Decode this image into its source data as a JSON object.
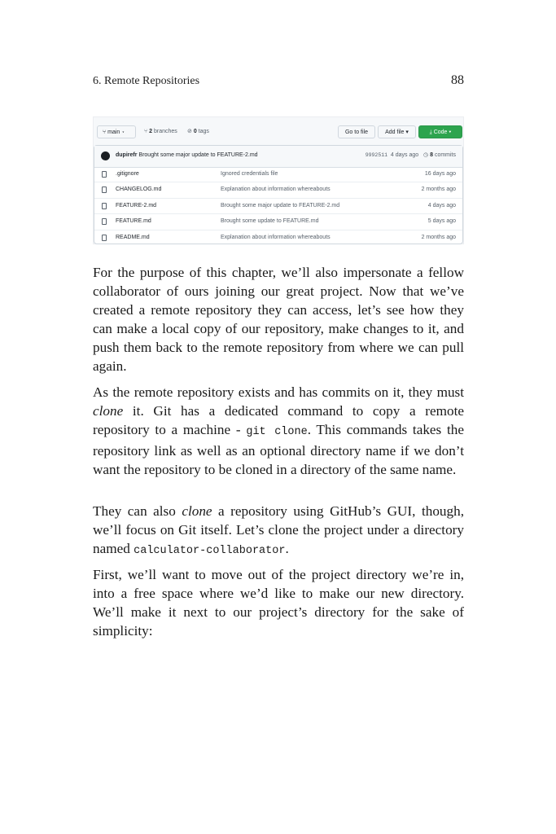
{
  "header": {
    "chapter": "6. Remote Repositories",
    "page_number": "88"
  },
  "repo_screenshot": {
    "branch_button": "main ▾",
    "branches_count": "2",
    "branches_label": "branches",
    "tags_count": "0",
    "tags_label": "tags",
    "go_to_file": "Go to file",
    "add_file": "Add file ▾",
    "code_button": "Code ▾",
    "code_button_color": "#2da44e",
    "latest_commit": {
      "author": "dupirefr",
      "message": "Brought some major update to FEATURE-2.md",
      "sha": "9992511",
      "age": "4 days ago",
      "commits_count": "8",
      "commits_label": "commits"
    },
    "files": [
      {
        "name": ".gitignore",
        "message": "Ignored credentials file",
        "age": "16 days ago"
      },
      {
        "name": "CHANGELOG.md",
        "message": "Explanation about information whereabouts",
        "age": "2 months ago"
      },
      {
        "name": "FEATURE-2.md",
        "message": "Brought some major update to FEATURE-2.md",
        "age": "4 days ago"
      },
      {
        "name": "FEATURE.md",
        "message": "Brought some update to FEATURE.md",
        "age": "5 days ago"
      },
      {
        "name": "README.md",
        "message": "Explanation about information whereabouts",
        "age": "2 months ago"
      }
    ]
  },
  "paragraphs": {
    "p1": "For the purpose of this chapter, we’ll also impersonate a fellow collaborator of ours joining our great project. Now that we’ve created a remote repository they can access, let’s see how they can make a local copy of our repository, make changes to it, and push them back to the remote repository from where we can pull again.",
    "p2_a": "As the remote repository exists and has commits on it, they must ",
    "p2_em": "clone",
    "p2_b": " it. Git has a dedicated command to copy a remote repository to a machine - ",
    "p2_code": "git clone",
    "p2_c": ". This commands takes the repository link as well as an optional directory name if we don’t want the repository to be cloned in a directory of the same name.",
    "p3_a": "They can also ",
    "p3_em": "clone",
    "p3_b": " a repository using GitHub’s GUI, though, we’ll focus on Git itself. Let’s clone the project under a directory named ",
    "p3_code": "calculator-collaborator",
    "p3_c": ".",
    "p4": "First, we’ll want to move out of the project directory we’re in, into a free space where we’d like to make our new directory. We’ll make it next to our project’s directory for the sake of simplicity:"
  }
}
